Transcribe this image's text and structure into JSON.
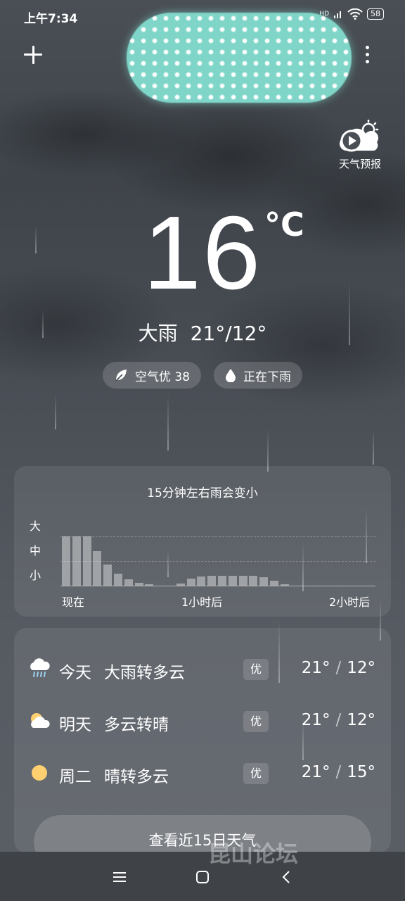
{
  "status_bar": {
    "time": "上午7:34",
    "network_label": "HD",
    "battery": "58"
  },
  "header": {
    "video_label": "天气预报"
  },
  "current": {
    "temperature": "16",
    "unit": "°C",
    "condition": "大雨",
    "range": "21°/12°",
    "air_quality": "空气优 38",
    "rain_status": "正在下雨"
  },
  "rain_forecast": {
    "title": "15分钟左右雨会变小",
    "y_labels": [
      "大",
      "中",
      "小"
    ],
    "x_labels": [
      "现在",
      "1小时后",
      "2小时后"
    ]
  },
  "chart_data": {
    "type": "bar",
    "title": "15分钟左右雨会变小",
    "y_categories": [
      "小",
      "中",
      "大"
    ],
    "x_ticks": [
      "现在",
      "1小时后",
      "2小时后"
    ],
    "ylim": [
      0,
      3
    ],
    "values": [
      2.0,
      2.0,
      2.0,
      1.4,
      0.85,
      0.5,
      0.25,
      0.12,
      0.05,
      0,
      0,
      0.1,
      0.3,
      0.38,
      0.4,
      0.4,
      0.4,
      0.4,
      0.4,
      0.35,
      0.2,
      0.05,
      0,
      0,
      0,
      0,
      0,
      0,
      0,
      0
    ]
  },
  "daily": [
    {
      "name": "今天",
      "condition": "大雨转多云",
      "aqi": "优",
      "high": "21°",
      "low": "12°",
      "icon": "heavy-rain-icon"
    },
    {
      "name": "明天",
      "condition": "多云转晴",
      "aqi": "优",
      "high": "21°",
      "low": "12°",
      "icon": "partly-cloudy-icon"
    },
    {
      "name": "周二",
      "condition": "晴转多云",
      "aqi": "优",
      "high": "21°",
      "low": "15°",
      "icon": "sun-icon"
    }
  ],
  "actions": {
    "fifteen_day_button": "查看近15日天气"
  },
  "watermark": "昆山论坛",
  "colors": {
    "location_blob": "#7fd6c8",
    "sun": "#ffd070"
  }
}
